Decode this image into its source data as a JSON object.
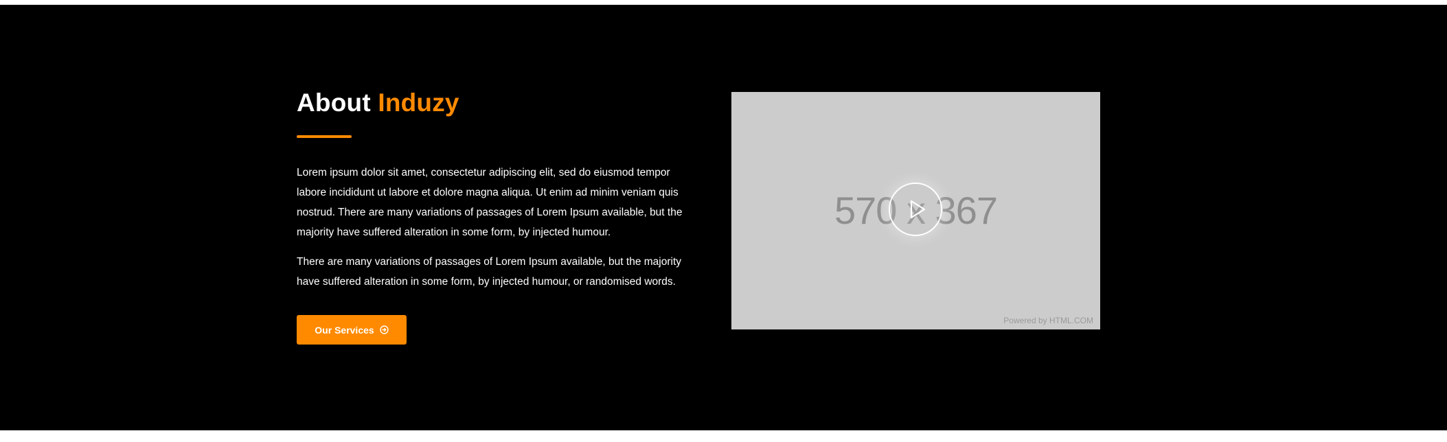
{
  "about": {
    "title_prefix": "About",
    "title_accent": "Induzy",
    "paragraph_1": "Lorem ipsum dolor sit amet, consectetur adipiscing elit, sed do eiusmod tempor labore incididunt ut labore et dolore magna aliqua. Ut enim ad minim veniam quis nostrud. There are many variations of passages of Lorem Ipsum available, but the majority have suffered alteration in some form, by injected humour.",
    "paragraph_2": "There are many variations of passages of Lorem Ipsum available, but the majority have suffered alteration in some form, by injected humour, or randomised words.",
    "button_label": "Our Services",
    "button_icon": "arrow-circle-right-icon"
  },
  "video": {
    "placeholder_text": "570 x 367",
    "powered_by": "Powered by HTML.COM",
    "play_icon": "play-icon"
  },
  "colors": {
    "accent": "#ff8a00",
    "background": "#000000",
    "text": "#ffffff",
    "placeholder_bg": "#cccccc"
  }
}
